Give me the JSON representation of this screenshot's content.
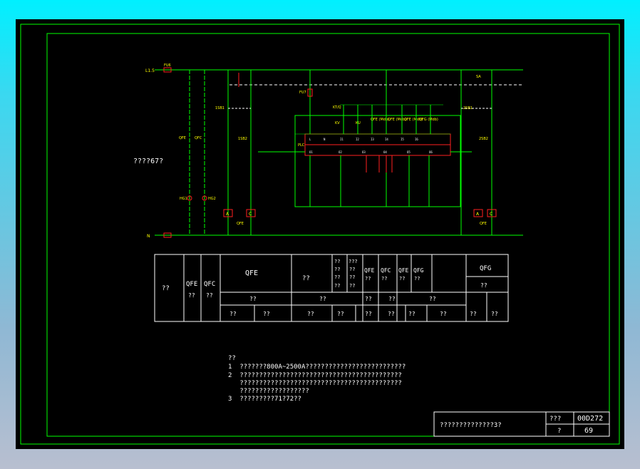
{
  "diagram": {
    "side_label": "????67?",
    "line_label": "L1.5",
    "neutral_label": "N",
    "fuse_label": "FU6",
    "top_right_fuse": "SA",
    "qfe_label": "QFE",
    "qfe2_label": "QFE",
    "plc_label": "PLC",
    "inputs": [
      "L",
      "N",
      "I1",
      "I2",
      "I3",
      "I4",
      "I5",
      "I6"
    ],
    "outputs": [
      "O1",
      "O2",
      "O3",
      "O4",
      "O5",
      "O6"
    ],
    "pilot_left": "HG1",
    "pilot_right": "HG2",
    "box_a": "A",
    "box_c": "C",
    "sb_left_1": "1SB1",
    "sb_left_2": "1SB2",
    "sb_right_1": "2SB1",
    "sb_right_2": "2SB2",
    "relay_labels": [
      "KT/Q",
      "KV",
      "KU",
      "QFE (Mdb)",
      "QFE (Mdb)",
      "QFE (Mdb)",
      "QFG (Mdb)"
    ]
  },
  "table": {
    "col_a": "??",
    "qfe": "QFE",
    "qfe_sub": "??",
    "qfc": "QFC",
    "qfc_sub": "??",
    "big_qfe": "QFE",
    "mid_label": "??",
    "stack_1": [
      "??",
      "??",
      "??",
      "??"
    ],
    "stack_2": [
      "???",
      "??",
      "??",
      "??"
    ],
    "qfe_b": "QFE",
    "qfe_b_sub": "??",
    "qfc_b": "QFC",
    "qfc_b_sub": "??",
    "qfe_c": "QFE",
    "qfe_c_sub": "??",
    "qfg": "QFG",
    "qfg_sub": "??",
    "qfg_right": "QFG",
    "qfg_right_sub": "??",
    "row2": [
      "??",
      "??",
      "??",
      "??",
      "??"
    ],
    "row3": [
      "??",
      "??",
      "??",
      "??",
      "??",
      "??",
      "??",
      "??",
      "??",
      "??",
      "??",
      "??"
    ]
  },
  "notes": {
    "title": "??",
    "lines": [
      "1  ???????800A~2500A??????????????????????????",
      "2  ??????????????????????????????????????????",
      "   ??????????????????????????????????????????",
      "   ??????????????????",
      "3  ?????????71?72??"
    ]
  },
  "titleblock": {
    "name": "??????????????3?",
    "h1": "???",
    "v1": "00D272",
    "h2": "?",
    "v2": "69"
  }
}
